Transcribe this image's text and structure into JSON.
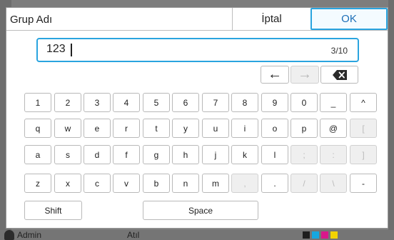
{
  "background": {
    "footer_user": "Admin",
    "footer_mode": "Atıl",
    "ink_colors": [
      "#1e1e1e",
      "#16a7e0",
      "#d8188b",
      "#f2d200"
    ]
  },
  "dialog": {
    "title": "Grup Adı",
    "cancel_label": "İptal",
    "ok_label": "OK",
    "accent_color": "#2aa4df"
  },
  "input": {
    "value": "123",
    "counter": "3/10"
  },
  "cursor_keys": {
    "left": "←",
    "right": "→",
    "backspace": "backspace-icon"
  },
  "keyboard": {
    "rows": [
      [
        "1",
        "2",
        "3",
        "4",
        "5",
        "6",
        "7",
        "8",
        "9",
        "0",
        "_",
        "^"
      ],
      [
        "q",
        "w",
        "e",
        "r",
        "t",
        "y",
        "u",
        "i",
        "o",
        "p",
        "@",
        "["
      ],
      [
        "a",
        "s",
        "d",
        "f",
        "g",
        "h",
        "j",
        "k",
        "l",
        ";",
        ":",
        "]"
      ],
      [
        "z",
        "x",
        "c",
        "v",
        "b",
        "n",
        "m",
        ",",
        ".",
        "/",
        "\\",
        "-"
      ]
    ],
    "shift_label": "Shift",
    "space_label": "Space"
  }
}
